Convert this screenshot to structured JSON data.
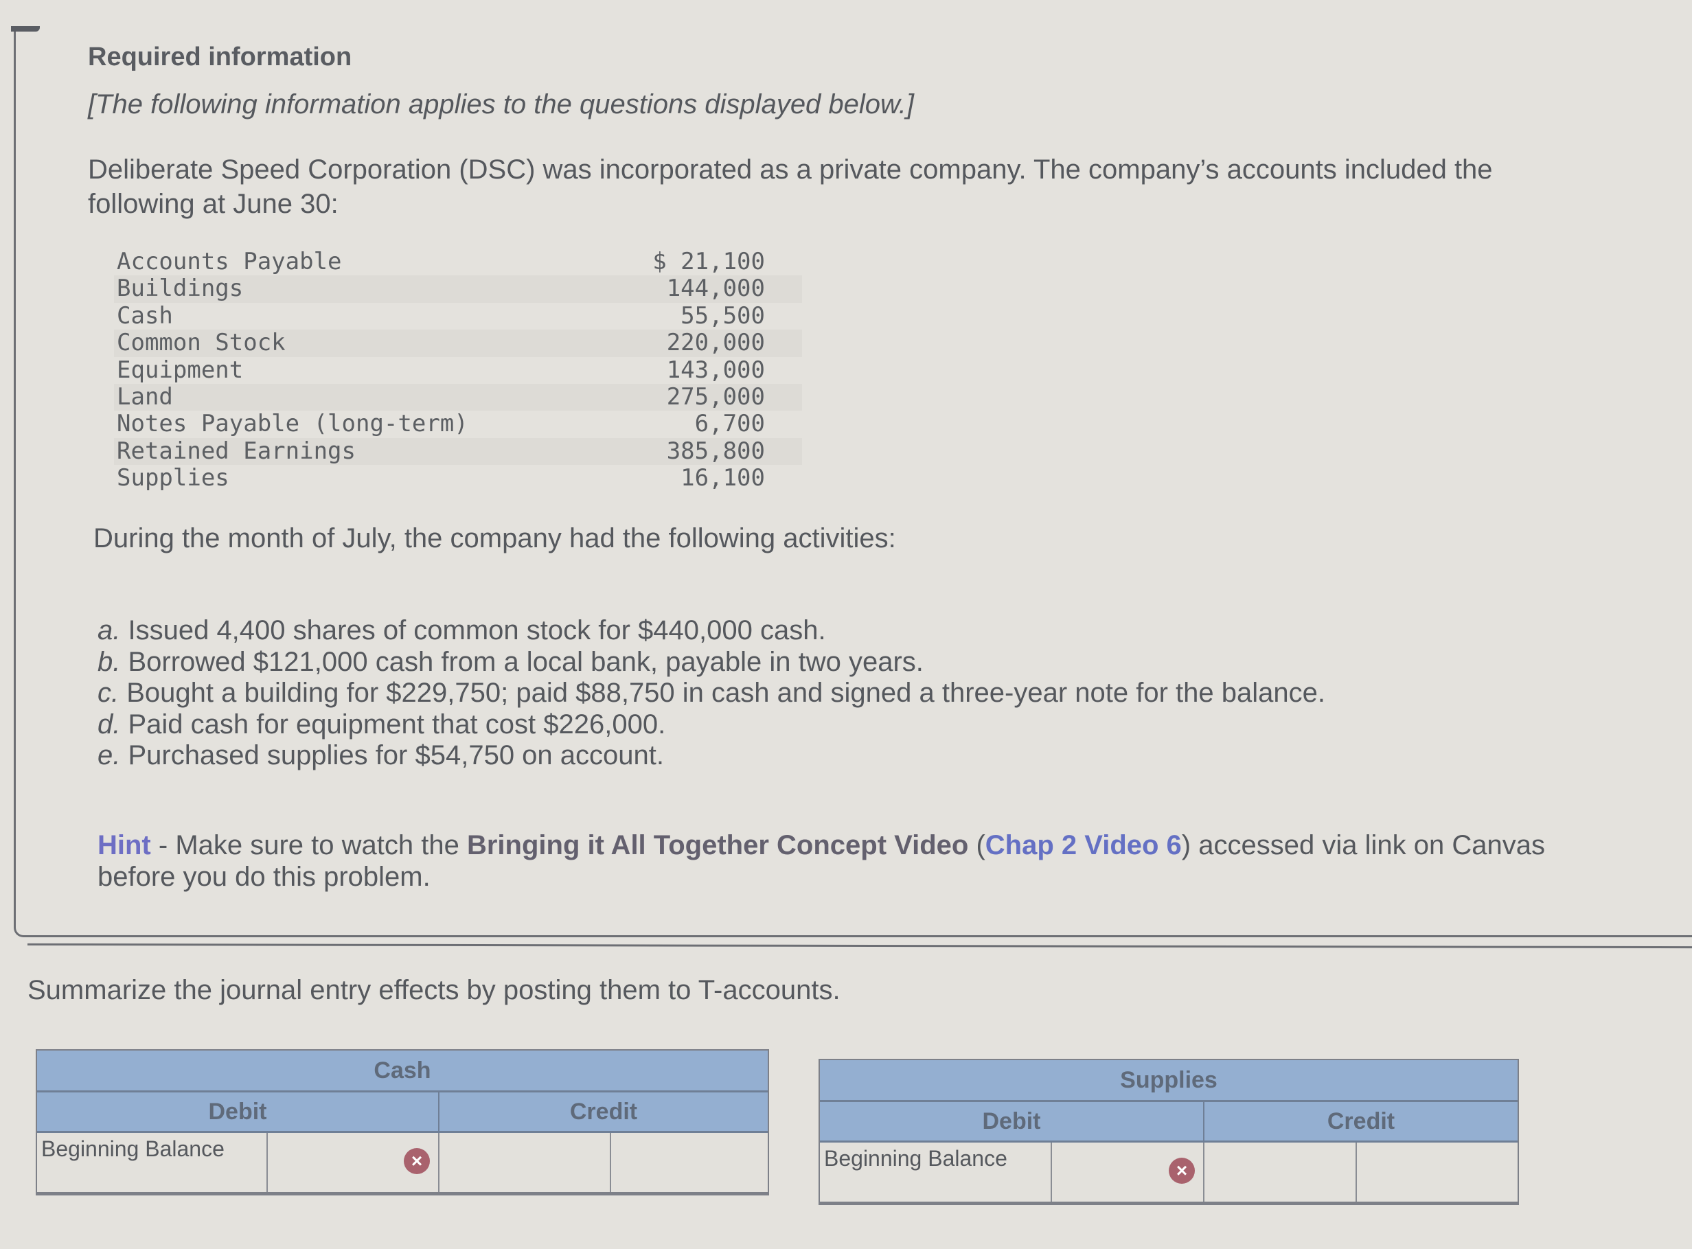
{
  "header": {
    "title": "Required information",
    "subtitle": "[The following information applies to the questions displayed below.]"
  },
  "intro": "Deliberate Speed Corporation (DSC) was incorporated as a private company. The company’s accounts included the following at June 30:",
  "accounts": [
    {
      "name": "Accounts Payable",
      "amount": "$ 21,100"
    },
    {
      "name": "Buildings",
      "amount": "144,000"
    },
    {
      "name": "Cash",
      "amount": "55,500"
    },
    {
      "name": "Common Stock",
      "amount": "220,000"
    },
    {
      "name": "Equipment",
      "amount": "143,000"
    },
    {
      "name": "Land",
      "amount": "275,000"
    },
    {
      "name": "Notes Payable (long-term)",
      "amount": "6,700"
    },
    {
      "name": "Retained Earnings",
      "amount": "385,800"
    },
    {
      "name": "Supplies",
      "amount": "16,100"
    }
  ],
  "activities_intro": "During the month of July, the company had the following activities:",
  "activities": [
    {
      "letter": "a.",
      "text": " Issued 4,400 shares of common stock for $440,000 cash."
    },
    {
      "letter": "b.",
      "text": " Borrowed $121,000 cash from a local bank, payable in two years."
    },
    {
      "letter": "c.",
      "text": " Bought a building for $229,750; paid $88,750 in cash and signed a three-year note for the balance."
    },
    {
      "letter": "d.",
      "text": " Paid cash for equipment that cost $226,000."
    },
    {
      "letter": "e.",
      "text": " Purchased supplies for $54,750 on account."
    }
  ],
  "hint": {
    "label": "Hint",
    "pre": " - Make sure to watch the ",
    "bold": "Bringing it All Together Concept Video",
    "open_paren": " (",
    "link": "Chap 2 Video 6",
    "post": ") accessed via link on Canvas before you do this problem."
  },
  "instructions": "Summarize the journal entry effects by posting them to T-accounts.",
  "t_accounts": [
    {
      "title": "Cash",
      "debit_label": "Debit",
      "credit_label": "Credit",
      "row_label": "Beginning Balance",
      "debit_value": "",
      "credit_value": "",
      "status_icon": "incorrect-x"
    },
    {
      "title": "Supplies",
      "debit_label": "Debit",
      "credit_label": "Credit",
      "row_label": "Beginning Balance",
      "debit_value": "",
      "credit_value": "",
      "status_icon": "incorrect-x"
    }
  ],
  "colors": {
    "header_fill": "#94afd1",
    "hint_label": "#6d6ec4",
    "hint_link": "#6470c4",
    "error_icon": "#a9626d"
  }
}
